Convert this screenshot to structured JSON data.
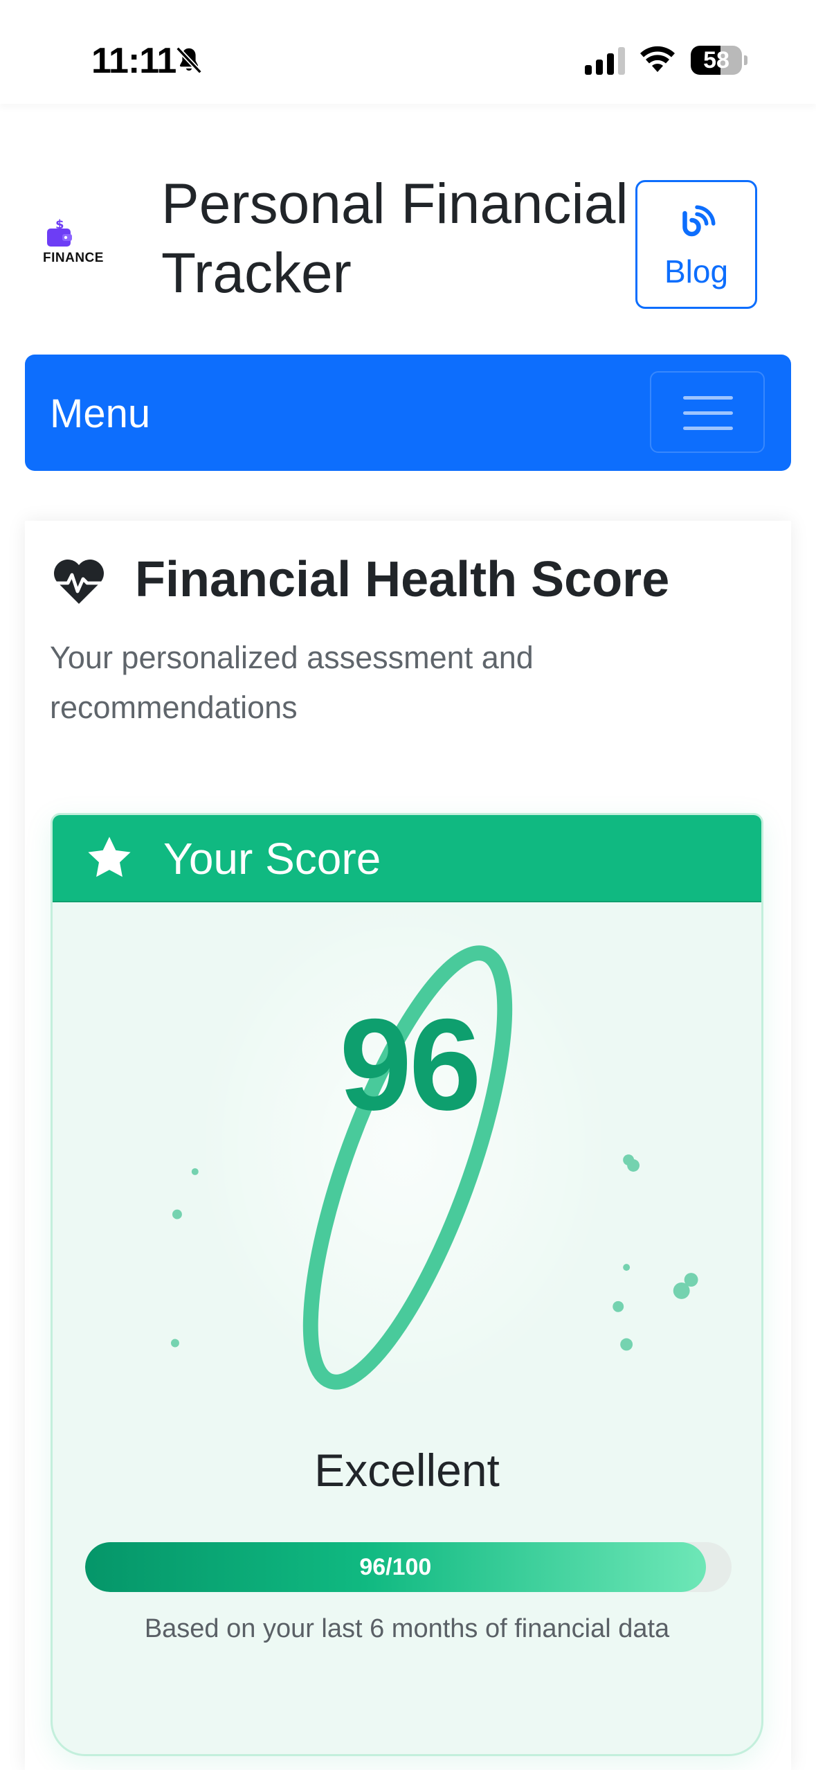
{
  "status_bar": {
    "time": "11:11",
    "battery": "58",
    "battery_level": 0.58,
    "icons": [
      "bell-slash-icon",
      "signal-icon",
      "wifi-icon",
      "battery-icon"
    ]
  },
  "header": {
    "logo_text": "FINANCE",
    "title": "Personal Financial Tracker",
    "blog_label": "Blog",
    "blog_icon": "blog-rss-icon"
  },
  "navbar": {
    "brand": "Menu",
    "toggler_icon": "hamburger-icon"
  },
  "health_card": {
    "icon": "heart-pulse-icon",
    "title": "Financial Health Score",
    "subtitle": "Your personalized assessment and recommendations"
  },
  "score_card": {
    "header_icon": "star-icon",
    "header_title": "Your Score",
    "score": "96",
    "rating": "Excellent",
    "progress_value": 96,
    "progress_max": 100,
    "progress_label": "96/100",
    "note": "Based on your last 6 months of financial data"
  },
  "colors": {
    "primary": "#0d6efd",
    "success": "#10b981",
    "success_dark": "#0e9f6e",
    "card_tint": "#edf9f4"
  }
}
